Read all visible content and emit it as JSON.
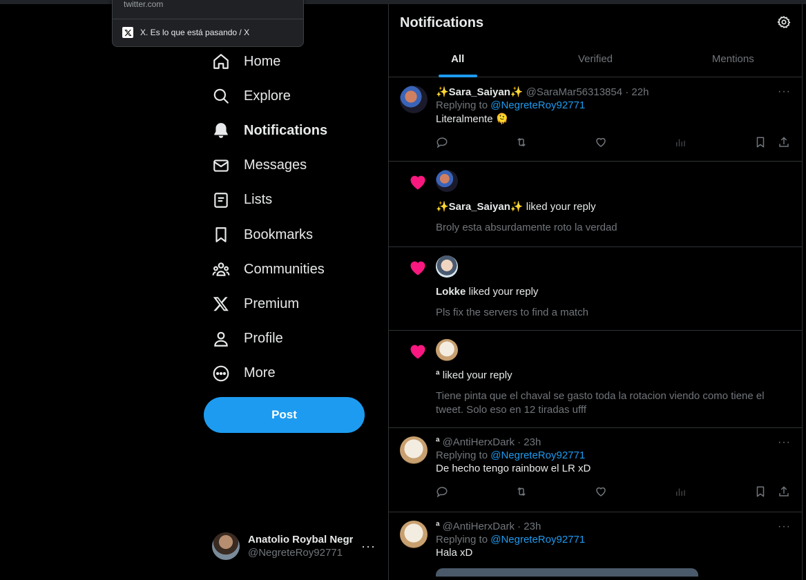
{
  "browser_tooltip": {
    "domain": "twitter.com",
    "page_title": "X. Es lo que está pasando / X"
  },
  "sidebar": {
    "items": [
      {
        "label": "Home",
        "icon": "home-icon"
      },
      {
        "label": "Explore",
        "icon": "search-icon"
      },
      {
        "label": "Notifications",
        "icon": "bell-icon",
        "active": true
      },
      {
        "label": "Messages",
        "icon": "mail-icon"
      },
      {
        "label": "Lists",
        "icon": "list-icon"
      },
      {
        "label": "Bookmarks",
        "icon": "bookmark-icon"
      },
      {
        "label": "Communities",
        "icon": "communities-icon"
      },
      {
        "label": "Premium",
        "icon": "x-logo-icon"
      },
      {
        "label": "Profile",
        "icon": "person-icon"
      },
      {
        "label": "More",
        "icon": "more-circle-icon"
      }
    ],
    "post_label": "Post",
    "account": {
      "display_name": "Anatolio Roybal Negr",
      "handle": "@NegreteRoy92771",
      "more": "···"
    }
  },
  "main": {
    "title": "Notifications",
    "tabs": [
      {
        "label": "All",
        "active": true
      },
      {
        "label": "Verified"
      },
      {
        "label": "Mentions"
      }
    ],
    "notifications": {
      "reply1": {
        "name": "✨Sara_Saiyan✨",
        "meta": "@SaraMar56313854 · 22h",
        "replying_prefix": "Replying to ",
        "replying_to": "@NegreteRoy92771",
        "text": "Literalmente 🫠"
      },
      "like1": {
        "name": "✨Sara_Saiyan✨",
        "action": " liked your reply",
        "quote": "Broly esta absurdamente roto la verdad"
      },
      "like2": {
        "name": "Lokke",
        "action": " liked your reply",
        "quote": "Pls fix the servers to find a match"
      },
      "like3": {
        "name": "ª",
        "action": " liked your reply",
        "quote": "Tiene pinta que el chaval se gasto toda la rotacion viendo como tiene el tweet. Solo eso en 12 tiradas ufff"
      },
      "reply2": {
        "name": "ª",
        "meta": "@AntiHerxDark · 23h",
        "replying_prefix": "Replying to ",
        "replying_to": "@NegreteRoy92771",
        "text": "De hecho tengo rainbow el LR xD"
      },
      "reply3": {
        "name": "ª",
        "meta": "@AntiHerxDark · 23h",
        "replying_prefix": "Replying to ",
        "replying_to": "@NegreteRoy92771",
        "text": "Hala xD"
      }
    }
  },
  "colors": {
    "accent": "#1d9bf0",
    "like": "#f91880",
    "muted": "#71767b",
    "border": "#2f3336"
  }
}
